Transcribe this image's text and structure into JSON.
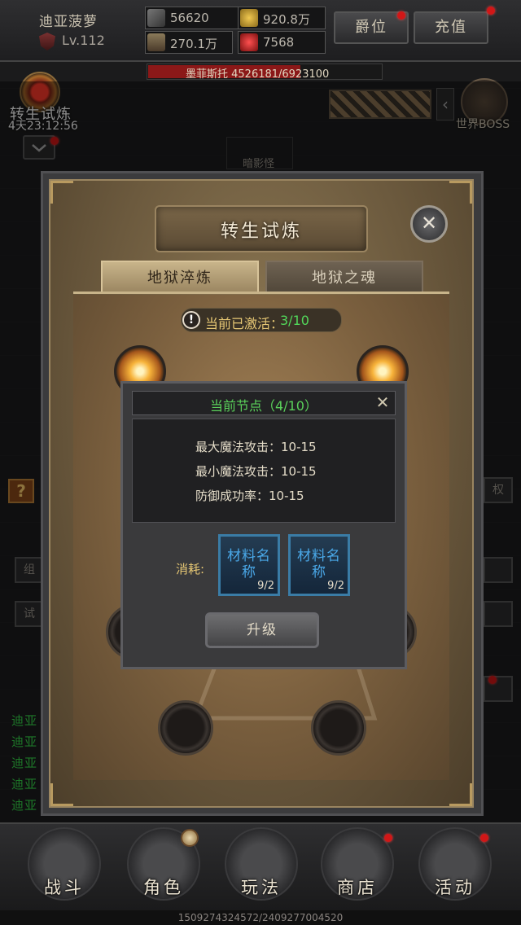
{
  "header": {
    "player_name": "迪亚菠萝",
    "level": "Lv.112",
    "stats": [
      {
        "icon": "crossed-swords-icon",
        "value": "56620"
      },
      {
        "icon": "gold-coins-icon",
        "value": "920.8万"
      },
      {
        "icon": "armor-icon",
        "value": "270.1万"
      },
      {
        "icon": "red-gem-icon",
        "value": "7568"
      }
    ],
    "rank_button": "爵位",
    "recharge_button": "充值"
  },
  "boss_bar": {
    "text": "墨菲斯托  4526181/6923100",
    "progress": 0.654,
    "color": "#8b1818"
  },
  "left_event": {
    "label": "转生试炼",
    "timer": "4天23:12:56"
  },
  "world_boss": {
    "label": "世界BOSS"
  },
  "monster": {
    "name": "暗影怪"
  },
  "side_buttons": {
    "right_label": "权",
    "left_1": "组",
    "left_2": "试"
  },
  "chat": {
    "lines": [
      "迪亚",
      "迪亚",
      "迪亚",
      "迪亚",
      "迪亚"
    ]
  },
  "panel": {
    "title": "转生试炼",
    "close_symbol": "✕",
    "tabs": [
      {
        "label": "地狱淬炼",
        "active": true
      },
      {
        "label": "地狱之魂",
        "active": false
      }
    ],
    "activated_label": "当前已激活：",
    "activated_count": "3/10",
    "info_symbol": "!"
  },
  "popup": {
    "title": "当前节点（4/10）",
    "close_symbol": "✕",
    "stats": [
      "最大魔法攻击：10-15",
      "最小魔法攻击：10-15",
      "防御成功率：10-15"
    ],
    "cost_label": "消耗:",
    "materials": [
      {
        "name": "材料名称",
        "count": "9/2"
      },
      {
        "name": "材料名称",
        "count": "9/2"
      }
    ],
    "upgrade_button": "升级"
  },
  "nav": {
    "items": [
      {
        "label": "战斗",
        "icon": "sword-icon"
      },
      {
        "label": "角色",
        "icon": "helmet-icon"
      },
      {
        "label": "玩法",
        "icon": "castle-icon"
      },
      {
        "label": "商店",
        "icon": "shop-icon"
      },
      {
        "label": "活动",
        "icon": "scales-icon"
      }
    ]
  },
  "footer": {
    "text": "1509274324572/2409277004520"
  },
  "colors": {
    "accent_gold": "#e6c774",
    "green": "#52d85a",
    "material_blue": "#4aa8e8",
    "alert_red": "#d11717"
  }
}
